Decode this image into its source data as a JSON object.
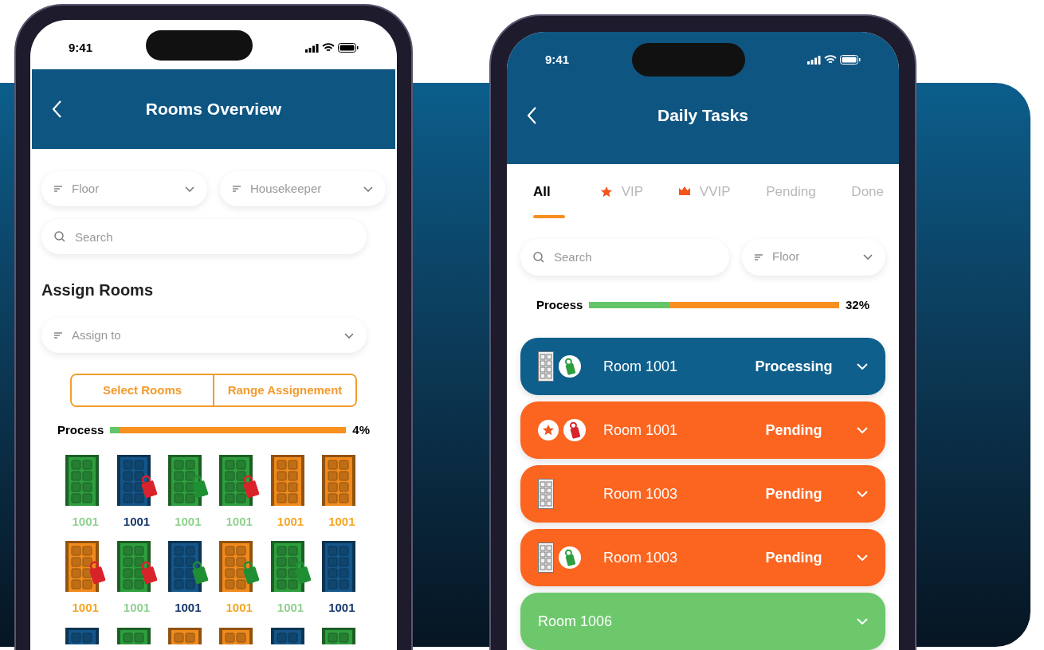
{
  "rooms_overview": {
    "status_time": "9:41",
    "title": "Rooms Overview",
    "filters": [
      {
        "label": "Floor"
      },
      {
        "label": "Housekeeper"
      }
    ],
    "search": {
      "placeholder": "Search"
    },
    "section_title": "Assign Rooms",
    "assign_to": {
      "label": "Assign to"
    },
    "modes": [
      {
        "label": "Select Rooms"
      },
      {
        "label": "Range Assignement"
      }
    ],
    "progress": {
      "label": "Process",
      "level": 0.04,
      "reading": "4%"
    },
    "doors": [
      {
        "color": "#2e9e3e",
        "kind": "plain",
        "number": "1001"
      },
      {
        "color": "#14568a",
        "kind": "tagged",
        "hanger": {
          "color": "#d9232a"
        },
        "number": "1001"
      },
      {
        "color": "#2e9e3e",
        "kind": "tagged",
        "hanger": {
          "color": "#1f8f33"
        },
        "number": "1001"
      },
      {
        "color": "#2e9e3e",
        "kind": "tagged",
        "hanger": {
          "color": "#d9232a"
        },
        "number": "1001"
      },
      {
        "color": "#f08a1c",
        "kind": "plain",
        "number": "1001"
      },
      {
        "color": "#f08a1c",
        "kind": "plain",
        "number": "1001"
      },
      {
        "color": "#f08a1c",
        "kind": "tagged",
        "hanger": {
          "color": "#d9232a"
        },
        "number": "1001"
      },
      {
        "color": "#2e9e3e",
        "kind": "tagged",
        "hanger": {
          "color": "#d9232a"
        },
        "number": "1001"
      },
      {
        "color": "#14568a",
        "kind": "tagged",
        "hanger": {
          "color": "#1f8f33"
        },
        "number": "1001"
      },
      {
        "color": "#f08a1c",
        "kind": "tagged",
        "hanger": {
          "color": "#1f8f33"
        },
        "number": "1001"
      },
      {
        "color": "#2e9e3e",
        "kind": "tagged",
        "hanger": {
          "color": "#1f8f33"
        },
        "number": "1001"
      },
      {
        "color": "#14568a",
        "kind": "plain",
        "number": "1001"
      },
      {
        "color": "#14568a",
        "kind": "plain"
      },
      {
        "color": "#2e9e3e",
        "kind": "plain"
      },
      {
        "color": "#f08a1c",
        "kind": "plain"
      },
      {
        "color": "#f08a1c",
        "kind": "plain"
      },
      {
        "color": "#14568a",
        "kind": "plain"
      },
      {
        "color": "#2e9e3e",
        "kind": "plain"
      }
    ]
  },
  "daily_tasks": {
    "status_time": "9:41",
    "title": "Daily Tasks",
    "tabs": [
      {
        "label": "All",
        "kind": "text",
        "selected": true
      },
      {
        "label": "VIP",
        "kind": "star",
        "selected": false
      },
      {
        "label": "VVIP",
        "kind": "crown",
        "selected": false
      },
      {
        "label": "Pending",
        "kind": "text",
        "selected": false
      },
      {
        "label": "Done",
        "kind": "text",
        "selected": false
      }
    ],
    "search": {
      "placeholder": "Search"
    },
    "floor_filter": {
      "label": "Floor"
    },
    "progress": {
      "label": "Process",
      "level": 0.32,
      "reading": "32%"
    },
    "tasks": [
      {
        "room": "Room 1001",
        "status": "Processing",
        "color": "#0e5f8c",
        "icons": [
          {
            "kind": "door"
          },
          {
            "kind": "hanger",
            "color": "#2e9e3e"
          }
        ]
      },
      {
        "room": "Room 1001",
        "status": "Pending",
        "color": "#fb6520",
        "icons": [
          {
            "kind": "star"
          },
          {
            "kind": "hanger",
            "color": "#d9232a"
          }
        ]
      },
      {
        "room": "Room 1003",
        "status": "Pending",
        "color": "#fb6520",
        "icons": [
          {
            "kind": "door"
          }
        ]
      },
      {
        "room": "Room 1003",
        "status": "Pending",
        "color": "#fb6520",
        "icons": [
          {
            "kind": "door"
          },
          {
            "kind": "hanger",
            "color": "#2e9e3e"
          }
        ]
      },
      {
        "room": "Room 1006",
        "color": "#6cc86b"
      }
    ]
  }
}
